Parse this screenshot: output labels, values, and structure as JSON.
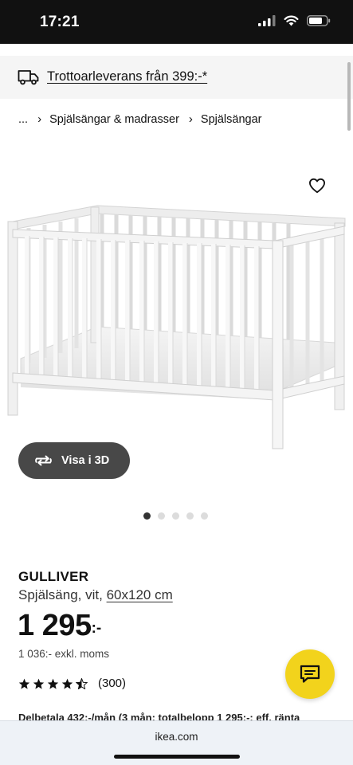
{
  "status_bar": {
    "time": "17:21"
  },
  "delivery_banner": {
    "icon": "truck-icon",
    "text": "Trottoarleverans från 399:-*"
  },
  "breadcrumb": {
    "items": [
      "...",
      "Spjälsängar & madrasser",
      "Spjälsängar"
    ]
  },
  "gallery": {
    "view_3d_label": "Visa i 3D",
    "total_images": 5,
    "active_index": 0
  },
  "product": {
    "name": "GULLIVER",
    "description": "Spjälsäng, vit,",
    "size": "60x120 cm",
    "price": "1 295",
    "price_suffix": ":-",
    "price_excl_vat": "1 036:- exkl. moms",
    "rating": 4.5,
    "rating_count": "(300)",
    "installment_text": "Delbetala 432:-/mån (3 mån; totalbelopp 1 295:-; eff. ränta"
  },
  "browser": {
    "url": "ikea.com"
  },
  "colors": {
    "status_bar_bg": "#111111",
    "banner_bg": "#f5f5f5",
    "chat_button": "#f2d31c",
    "view_3d_button": "#484848"
  }
}
